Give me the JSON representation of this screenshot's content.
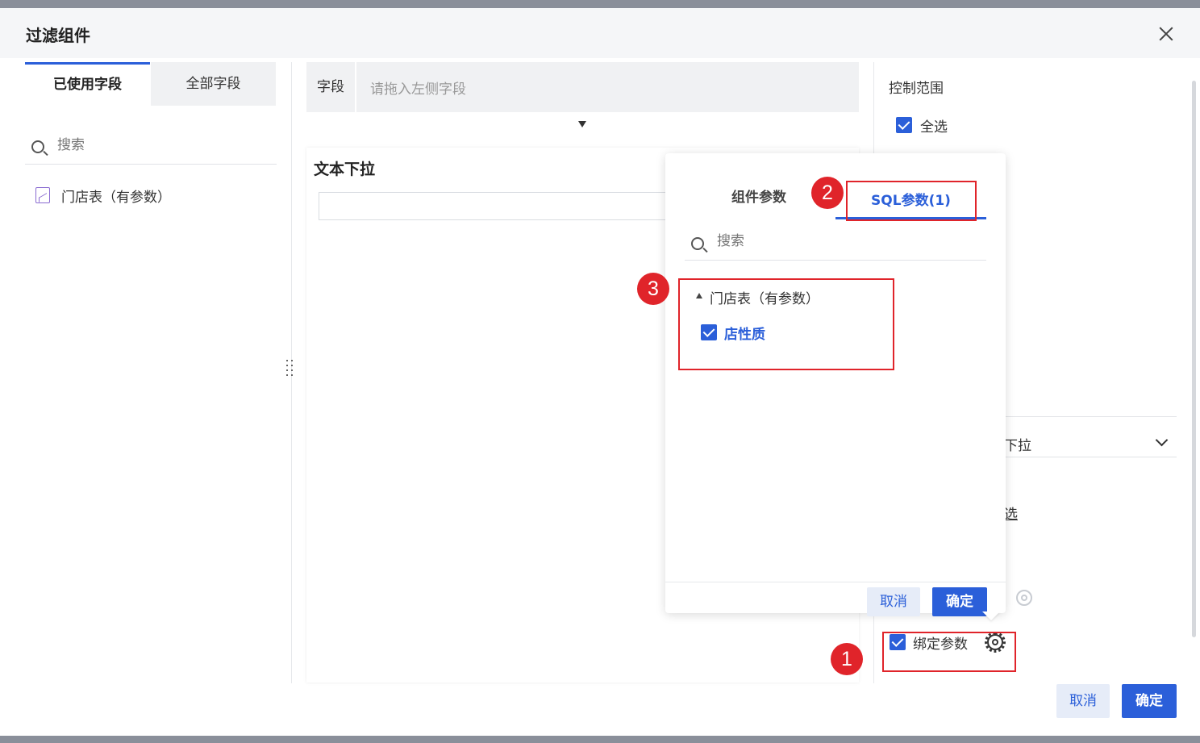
{
  "dialog": {
    "title": "过滤组件"
  },
  "left_panel": {
    "tabs": [
      {
        "label": "已使用字段",
        "active": true
      },
      {
        "label": "全部字段",
        "active": false
      }
    ],
    "search_placeholder": "搜索",
    "datasets": [
      {
        "label": "门店表（有参数）",
        "icon": "line-chart-icon"
      }
    ]
  },
  "middle_panel": {
    "field_label": "字段",
    "field_placeholder": "请拖入左侧字段",
    "preview_title": "文本下拉"
  },
  "right_panel": {
    "scope_label": "控制范围",
    "select_all_label": "全选",
    "select_all_checked": true,
    "type_value_partial": "下拉",
    "link_partial": "选",
    "bind_param_label": "绑定参数",
    "bind_param_checked": true
  },
  "popover": {
    "tabs": [
      {
        "label": "组件参数",
        "active": false
      },
      {
        "label": "SQL参数(1)",
        "active": true
      }
    ],
    "search_placeholder": "搜索",
    "tree": {
      "table_label": "门店表（有参数）",
      "fields": [
        {
          "label": "店性质",
          "checked": true
        }
      ]
    },
    "cancel_label": "取消",
    "ok_label": "确定"
  },
  "footer": {
    "cancel_label": "取消",
    "ok_label": "确定"
  },
  "annotations": {
    "badges": [
      "1",
      "2",
      "3"
    ]
  },
  "colors": {
    "accent": "#2b5fd9",
    "annotation_red": "#e0242a"
  }
}
